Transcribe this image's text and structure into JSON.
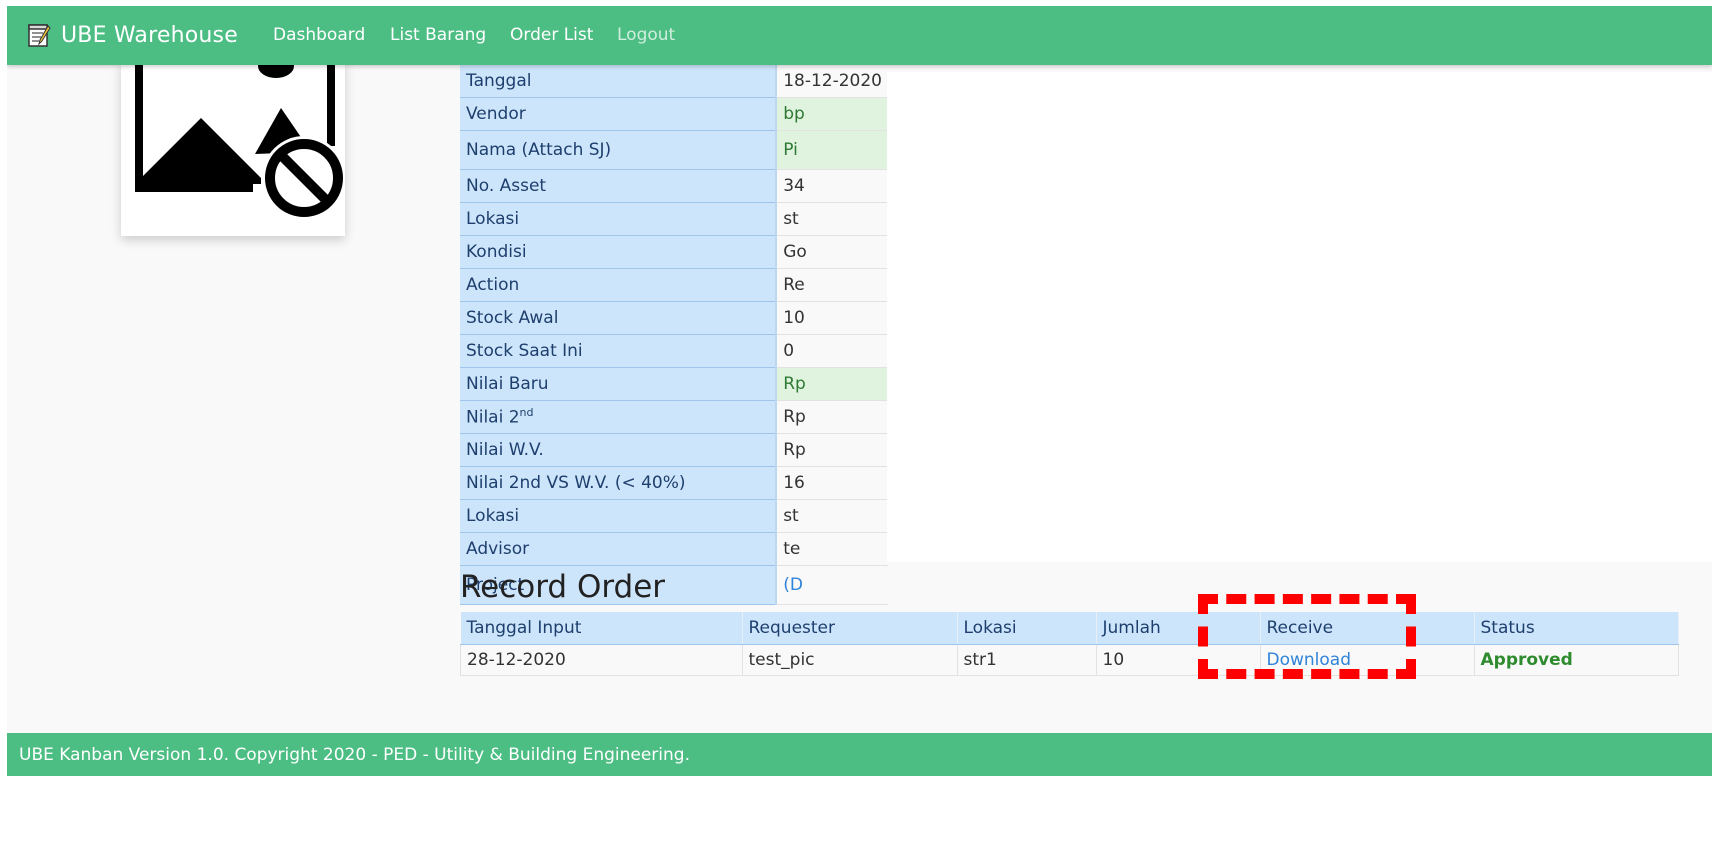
{
  "navbar": {
    "brand": "UBE Warehouse",
    "brand_icon": "memo-icon",
    "links": [
      "Dashboard",
      "List Barang",
      "Order List",
      "Logout"
    ],
    "color": "#4cbe83"
  },
  "image_card": {
    "icon": "broken-image-icon"
  },
  "detail": {
    "rows": [
      {
        "label": "Tanggal",
        "value": "18-12-2020"
      },
      {
        "label": "Vendor",
        "value": "bp"
      },
      {
        "label": "Nama (Attach SJ)",
        "value": "Pi"
      },
      {
        "label": "No. Asset",
        "value": "34"
      },
      {
        "label": "Lokasi",
        "value": "st"
      },
      {
        "label": "Kondisi",
        "value": "Go"
      },
      {
        "label": "Action",
        "value": "Re"
      },
      {
        "label": "Stock Awal",
        "value": "10"
      },
      {
        "label": "Stock Saat Ini",
        "value": "0"
      },
      {
        "label": "Nilai Baru",
        "value": "Rp"
      },
      {
        "label": "Nilai 2",
        "label_sup": "nd",
        "value": "Rp"
      },
      {
        "label": "Nilai W.V.",
        "value": "Rp"
      },
      {
        "label": "Nilai 2nd VS W.V. (< 40%)",
        "value": "16"
      },
      {
        "label": "Lokasi",
        "value": "st"
      },
      {
        "label": "Advisor",
        "value": "te"
      },
      {
        "label": "Project",
        "value": "(D"
      }
    ]
  },
  "record_order": {
    "title": "Record Order",
    "headers": [
      "Tanggal Input",
      "Requester",
      "Lokasi",
      "Jumlah",
      "Receive",
      "Status"
    ],
    "rows": [
      {
        "tanggal": "28-12-2020",
        "requester": "test_pic",
        "lokasi": "str1",
        "jumlah": "10",
        "receive": "Download",
        "status": "Approved"
      }
    ]
  },
  "footer": {
    "text": "UBE Kanban Version 1.0. Copyright 2020 - PED - Utility & Building Engineering."
  },
  "colors": {
    "accent": "#4cbe83",
    "table_header": "#cde5fb",
    "link": "#2f83d8",
    "approved": "#2e8b2e",
    "highlight": "#ff0000"
  }
}
